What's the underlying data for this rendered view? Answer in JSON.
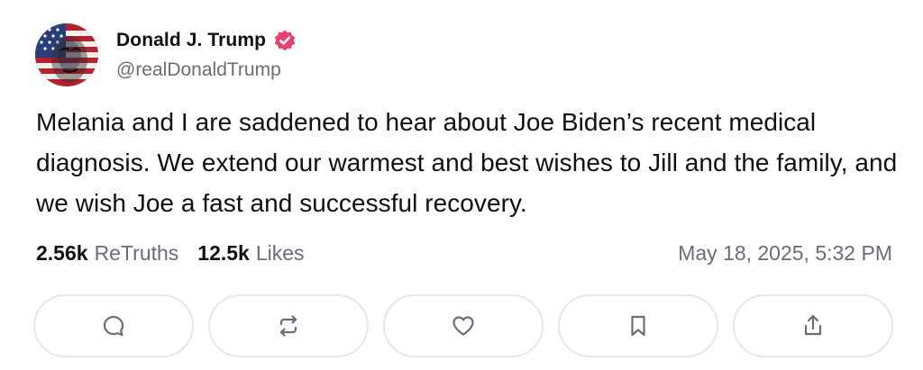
{
  "post": {
    "author": {
      "display_name": "Donald J. Trump",
      "handle": "@realDonaldTrump",
      "verified": true,
      "verified_color": "#e8416e",
      "avatar_icon": "flag-portrait-avatar"
    },
    "content": "Melania and I are saddened to hear about Joe Biden’s recent medical diagnosis. We extend our warmest and best wishes to Jill and the family, and we wish Joe a fast and successful recovery.",
    "stats": {
      "retruths_count": "2.56k",
      "retruths_label": "ReTruths",
      "likes_count": "12.5k",
      "likes_label": "Likes"
    },
    "timestamp": "May 18, 2025, 5:32 PM",
    "actions": [
      {
        "name": "reply",
        "icon": "comment-icon"
      },
      {
        "name": "retruth",
        "icon": "repost-icon"
      },
      {
        "name": "like",
        "icon": "heart-icon"
      },
      {
        "name": "bookmark",
        "icon": "bookmark-icon"
      },
      {
        "name": "share",
        "icon": "share-icon"
      }
    ]
  }
}
